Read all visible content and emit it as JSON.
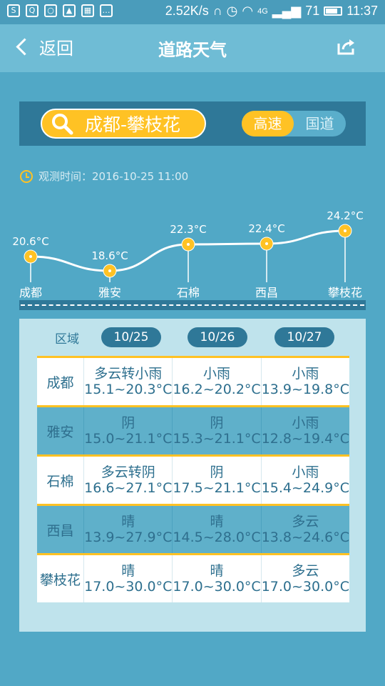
{
  "status": {
    "speed": "2.52K/s",
    "signal": "4G",
    "battery": "71",
    "time": "11:37"
  },
  "header": {
    "back": "返回",
    "title": "道路天气"
  },
  "search": {
    "route": "成都-攀枝花",
    "toggle": [
      "高速",
      "国道"
    ]
  },
  "observation": {
    "label": "观测时间：",
    "time": "2016-10-25 11:00"
  },
  "chart_data": {
    "type": "line",
    "categories": [
      "成都",
      "雅安",
      "石棉",
      "西昌",
      "攀枝花"
    ],
    "values": [
      20.6,
      18.6,
      22.3,
      22.4,
      24.2
    ],
    "labels": [
      "20.6°C",
      "18.6°C",
      "22.3°C",
      "22.4°C",
      "24.2°C"
    ],
    "ylim": [
      18,
      25
    ]
  },
  "table": {
    "region_label": "区域",
    "dates": [
      "10/25",
      "10/26",
      "10/27"
    ],
    "rows": [
      {
        "city": "成都",
        "cells": [
          {
            "w": "多云转小雨",
            "t": "15.1~20.3°C"
          },
          {
            "w": "小雨",
            "t": "16.2~20.2°C"
          },
          {
            "w": "小雨",
            "t": "13.9~19.8°C"
          }
        ]
      },
      {
        "city": "雅安",
        "cells": [
          {
            "w": "阴",
            "t": "15.0~21.1°C"
          },
          {
            "w": "阴",
            "t": "15.3~21.1°C"
          },
          {
            "w": "小雨",
            "t": "12.8~19.4°C"
          }
        ]
      },
      {
        "city": "石棉",
        "cells": [
          {
            "w": "多云转阴",
            "t": "16.6~27.1°C"
          },
          {
            "w": "阴",
            "t": "17.5~21.1°C"
          },
          {
            "w": "小雨",
            "t": "15.4~24.9°C"
          }
        ]
      },
      {
        "city": "西昌",
        "cells": [
          {
            "w": "晴",
            "t": "13.9~27.9°C"
          },
          {
            "w": "晴",
            "t": "14.5~28.0°C"
          },
          {
            "w": "多云",
            "t": "13.8~24.6°C"
          }
        ]
      },
      {
        "city": "攀枝花",
        "cells": [
          {
            "w": "晴",
            "t": "17.0~30.0°C"
          },
          {
            "w": "晴",
            "t": "17.0~30.0°C"
          },
          {
            "w": "多云",
            "t": "17.0~30.0°C"
          }
        ]
      }
    ]
  },
  "colors": {
    "accent": "#ffc224",
    "dark": "#2f7898",
    "bg": "#51a8c6"
  }
}
